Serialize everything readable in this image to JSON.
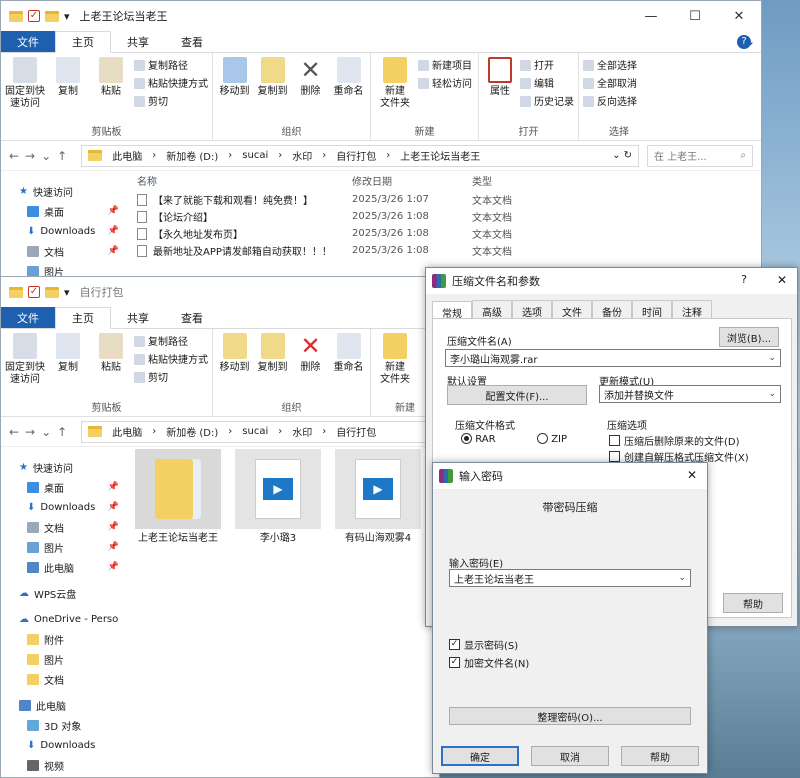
{
  "win1": {
    "title": "上老王论坛当老王",
    "tabs": [
      "文件",
      "主页",
      "共享",
      "查看"
    ],
    "ribbon": {
      "pin": "固定到快\n速访问",
      "copy": "复制",
      "paste": "粘贴",
      "copy_path": "复制路径",
      "paste_shortcut": "粘贴快捷方式",
      "cut": "剪切",
      "g_clip": "剪贴板",
      "move_to": "移动到",
      "copy_to": "复制到",
      "delete": "删除",
      "rename": "重命名",
      "g_org": "组织",
      "new_item": "新建项目",
      "easy_access": "轻松访问",
      "new_folder": "新建\n文件夹",
      "g_new": "新建",
      "properties": "属性",
      "open": "打开",
      "edit": "编辑",
      "history": "历史记录",
      "g_open": "打开",
      "select_all": "全部选择",
      "select_none": "全部取消",
      "invert": "反向选择",
      "g_select": "选择"
    },
    "path": [
      "此电脑",
      "新加卷 (D:)",
      "sucai",
      "水印",
      "自行打包",
      "上老王论坛当老王"
    ],
    "search": "在 上老王...",
    "sidebar": [
      "快速访问",
      "桌面",
      "Downloads",
      "文档",
      "图片"
    ],
    "columns": [
      "名称",
      "修改日期",
      "类型"
    ],
    "files": [
      {
        "name": "【来了就能下载和观看！纯免费！】",
        "date": "2025/3/26 1:07",
        "type": "文本文档"
      },
      {
        "name": "【论坛介绍】",
        "date": "2025/3/26 1:08",
        "type": "文本文档"
      },
      {
        "name": "【永久地址发布页】",
        "date": "2025/3/26 1:08",
        "type": "文本文档"
      },
      {
        "name": "最新地址及APP请发邮箱自动获取！！！",
        "date": "2025/3/26 1:08",
        "type": "文本文档"
      }
    ]
  },
  "win2": {
    "title": "自行打包",
    "tabs": [
      "文件",
      "主页",
      "共享",
      "查看"
    ],
    "path": [
      "此电脑",
      "新加卷 (D:)",
      "sucai",
      "水印",
      "自行打包"
    ],
    "sidebar": [
      "快速访问",
      "桌面",
      "Downloads",
      "文档",
      "图片",
      "此电脑",
      "WPS云盘",
      "OneDrive - Perso",
      "附件",
      "图片",
      "文档",
      "此电脑",
      "3D 对象",
      "Downloads",
      "视频"
    ],
    "tiles": [
      "上老王论坛当老王",
      "李小璐3",
      "有码山海观雾4"
    ]
  },
  "rar": {
    "title": "压缩文件名和参数",
    "help": "?",
    "tabs": [
      "常规",
      "高级",
      "选项",
      "文件",
      "备份",
      "时间",
      "注释"
    ],
    "archive_label": "压缩文件名(A)",
    "archive_value": "李小璐山海观雾.rar",
    "browse": "浏览(B)...",
    "profile_label": "默认设置",
    "profiles_btn": "配置文件(F)...",
    "update_label": "更新模式(U)",
    "update_value": "添加并替换文件",
    "format_label": "压缩文件格式",
    "fmt_rar": "RAR",
    "fmt_zip": "ZIP",
    "options_label": "压缩选项",
    "opt1": "压缩后删除原来的文件(D)",
    "opt2": "创建自解压格式压缩文件(X)",
    "help_btn": "帮助"
  },
  "pwd": {
    "title": "输入密码",
    "heading": "带密码压缩",
    "enter_label": "输入密码(E)",
    "password": "上老王论坛当老王",
    "show": "显示密码(S)",
    "encrypt": "加密文件名(N)",
    "organize": "整理密码(O)...",
    "ok": "确定",
    "cancel": "取消",
    "help": "帮助"
  }
}
